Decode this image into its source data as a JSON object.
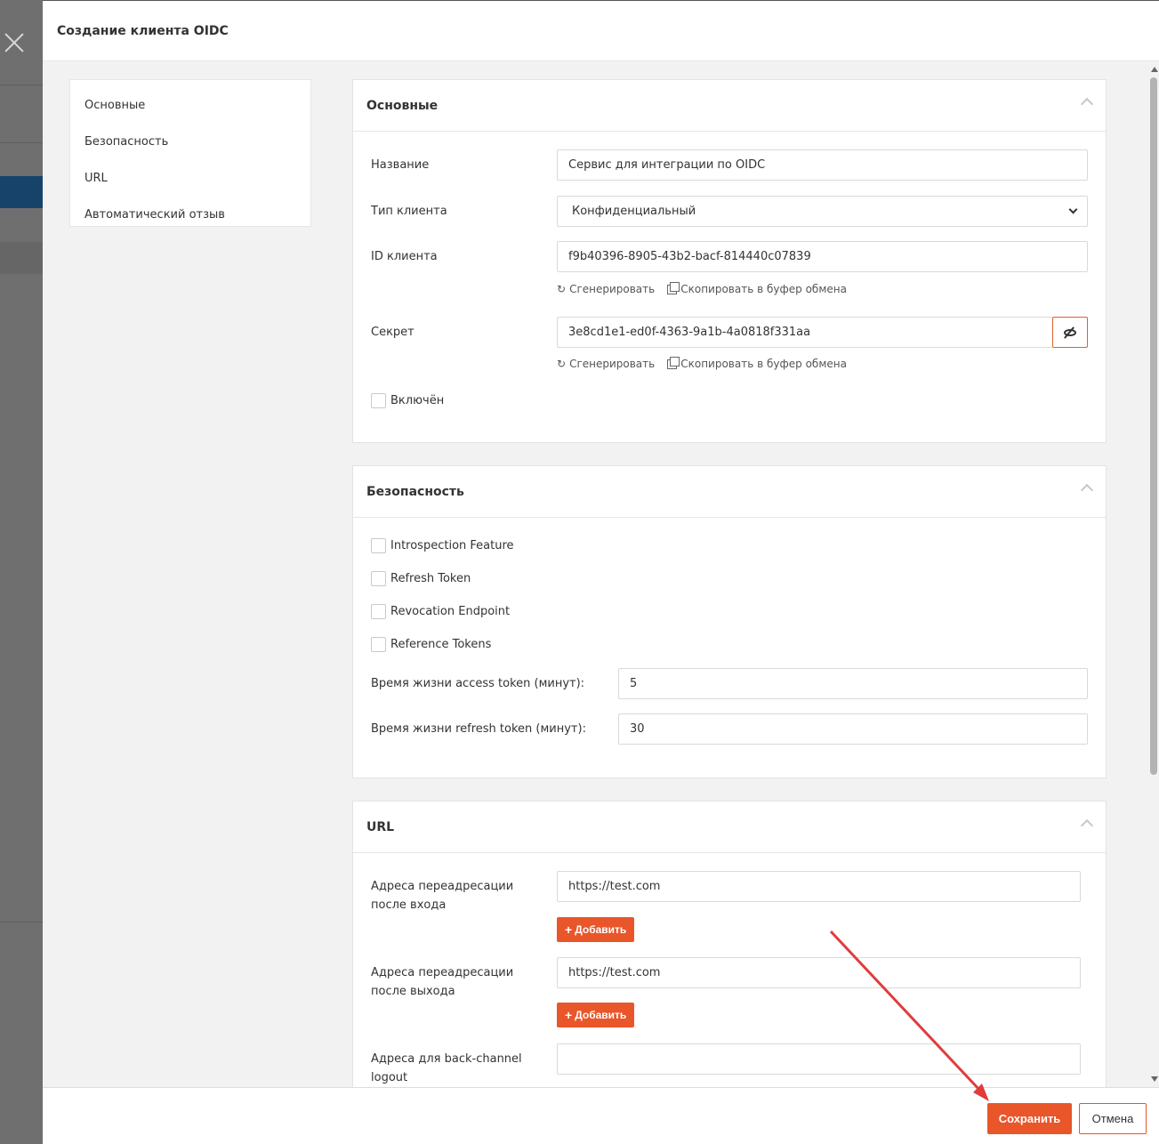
{
  "modal": {
    "title": "Создание клиента OIDC"
  },
  "sidenav": {
    "items": [
      {
        "label": "Основные"
      },
      {
        "label": "Безопасность"
      },
      {
        "label": "URL"
      },
      {
        "label": "Автоматический отзыв"
      }
    ]
  },
  "basic": {
    "title": "Основные",
    "name_label": "Название",
    "name_value": "Сервис для интеграции по OIDC",
    "client_type_label": "Тип клиента",
    "client_type_value": "Конфиденциальный",
    "client_id_label": "ID клиента",
    "client_id_value": "f9b40396-8905-43b2-bacf-814440c07839",
    "secret_label": "Секрет",
    "secret_value": "3e8cd1e1-ed0f-4363-9a1b-4a0818f331aa",
    "generate_label": "Сгенерировать",
    "copy_label": "Скопировать в буфер обмена",
    "enabled_label": "Включён"
  },
  "security": {
    "title": "Безопасность",
    "checks": [
      {
        "label": "Introspection Feature"
      },
      {
        "label": "Refresh Token"
      },
      {
        "label": "Revocation Endpoint"
      },
      {
        "label": "Reference Tokens"
      }
    ],
    "access_ttl_label": "Время жизни access token (минут):",
    "access_ttl_value": "5",
    "refresh_ttl_label": "Время жизни refresh token (минут):",
    "refresh_ttl_value": "30"
  },
  "url": {
    "title": "URL",
    "redirect_login_label": "Адреса переадресации после входа",
    "redirect_login_value": "https://test.com",
    "redirect_logout_label": "Адреса переадресации после выхода",
    "redirect_logout_value": "https://test.com",
    "backchannel_label": "Адреса для back-channel logout",
    "backchannel_value": "",
    "add_label": "Добавить"
  },
  "footer": {
    "save_label": "Сохранить",
    "cancel_label": "Отмена"
  },
  "colors": {
    "accent": "#e8562a",
    "annotation_arrow": "#e03c3c"
  }
}
